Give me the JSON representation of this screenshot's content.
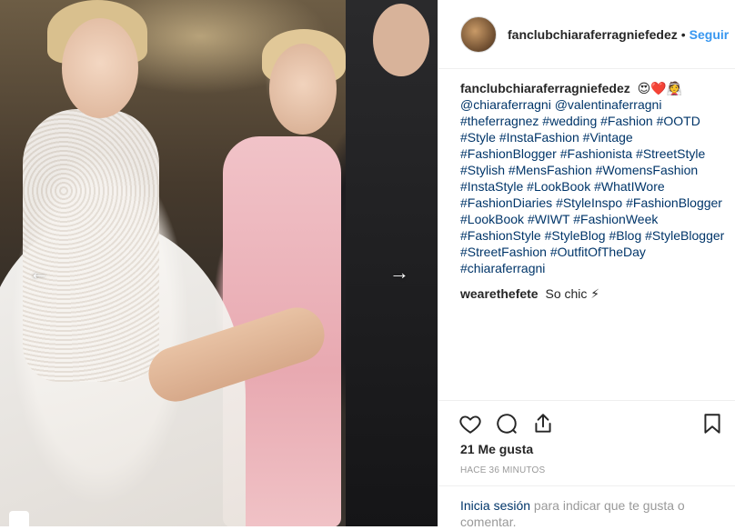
{
  "post": {
    "username": "fanclubchiaraferragniefedez",
    "separator": "•",
    "follow_label": "Seguir",
    "caption": {
      "author": "fanclubchiaraferragniefedez",
      "emoji": "😍❤️👰",
      "mentions": [
        "@chiaraferragni",
        "@valentinaferragni"
      ],
      "hashtags": [
        "#theferragnez",
        "#wedding",
        "#Fashion",
        "#OOTD",
        "#Style",
        "#InstaFashion",
        "#Vintage",
        "#FashionBlogger",
        "#Fashionista",
        "#StreetStyle",
        "#Stylish",
        "#MensFashion",
        "#WomensFashion",
        "#InstaStyle",
        "#LookBook",
        "#WhatIWore",
        "#FashionDiaries",
        "#StyleInspo",
        "#FashionBlogger",
        "#LookBook",
        "#WIWT",
        "#FashionWeek",
        "#FashionStyle",
        "#StyleBlog",
        "#Blog",
        "#StyleBlogger",
        "#StreetFashion",
        "#OutfitOfTheDay",
        "#chiaraferragni"
      ]
    },
    "comments": [
      {
        "author": "wearethefete",
        "text": "So chic ⚡"
      }
    ],
    "likes_label": "21 Me gusta",
    "time_label": "HACE 36 MINUTOS",
    "login": {
      "link": "Inicia sesión",
      "rest": " para indicar que te gusta o comentar."
    },
    "icons": {
      "like": "heart-icon",
      "comment": "comment-bubble-icon",
      "share": "share-icon",
      "save": "bookmark-icon",
      "prev": "chevron-left-icon",
      "next": "chevron-right-icon"
    },
    "colors": {
      "follow": "#3897f0",
      "link": "#003569",
      "muted": "#999999",
      "text": "#262626"
    }
  }
}
